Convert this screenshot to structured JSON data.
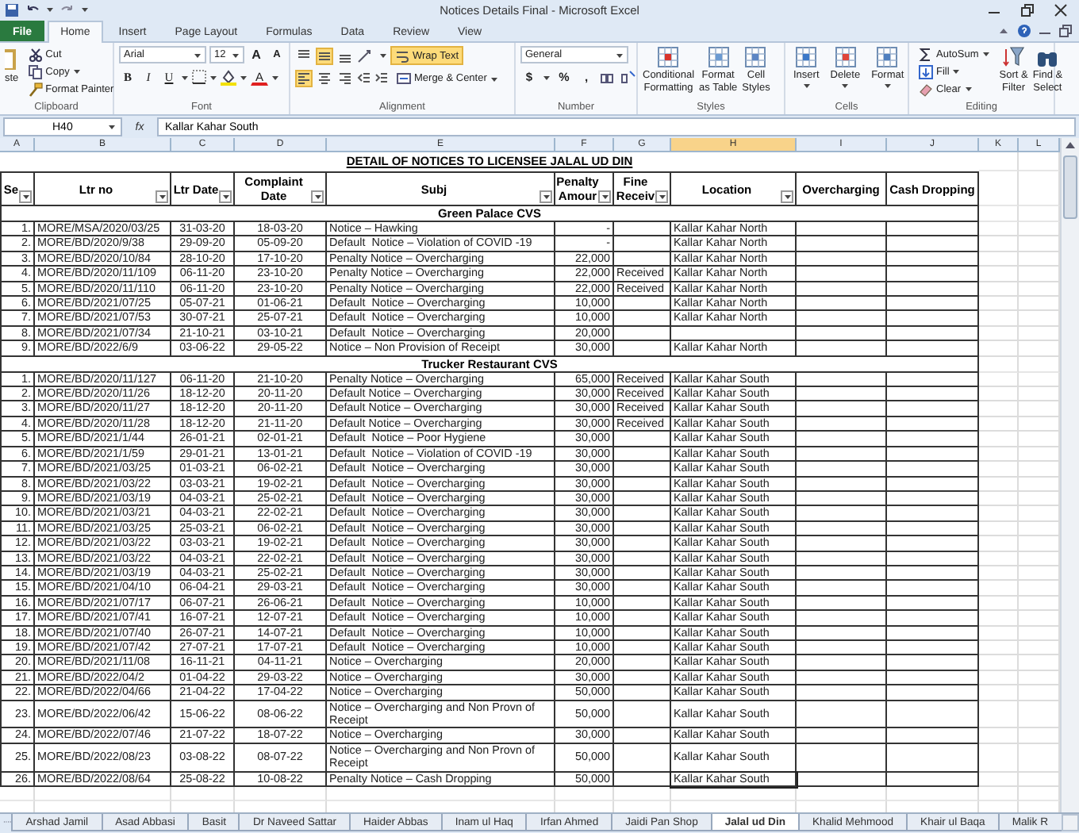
{
  "window": {
    "title": "Notices Details Final  -  Microsoft Excel"
  },
  "ribbon_tabs": [
    {
      "label": "File",
      "selected": false,
      "kind": "file"
    },
    {
      "label": "Home",
      "selected": true,
      "kind": "tab"
    },
    {
      "label": "Insert",
      "selected": false,
      "kind": "tab"
    },
    {
      "label": "Page Layout",
      "selected": false,
      "kind": "tab"
    },
    {
      "label": "Formulas",
      "selected": false,
      "kind": "tab"
    },
    {
      "label": "Data",
      "selected": false,
      "kind": "tab"
    },
    {
      "label": "Review",
      "selected": false,
      "kind": "tab"
    },
    {
      "label": "View",
      "selected": false,
      "kind": "tab"
    }
  ],
  "ribbon_groups": [
    {
      "kind": "clipboard",
      "label": "Clipboard",
      "paste": "ste",
      "buttons": [
        "Cut",
        "Copy",
        "Format Painter"
      ]
    },
    {
      "kind": "font",
      "label": "Font",
      "font_name": "Arial",
      "font_size": "12",
      "size_buttons": [
        "A",
        "A"
      ],
      "style_buttons": [
        "B",
        "I",
        "U"
      ],
      "color_button": "A"
    },
    {
      "kind": "alignment",
      "label": "Alignment",
      "align_buttons": [
        {
          "kind": "top",
          "selected": false
        },
        {
          "kind": "middle",
          "selected": true
        },
        {
          "kind": "bottom",
          "selected": false
        },
        {
          "kind": "left",
          "selected": true
        },
        {
          "kind": "center",
          "selected": false
        },
        {
          "kind": "right",
          "selected": false
        }
      ],
      "wrap": {
        "label": "Wrap Text",
        "selected": true
      },
      "merge": "Merge & Center"
    },
    {
      "kind": "number",
      "label": "Number",
      "format": "General",
      "buttons": [
        "$",
        "%",
        ","
      ]
    },
    {
      "kind": "styles",
      "label": "Styles",
      "buttons": [
        [
          "Conditional",
          "Formatting"
        ],
        [
          "Format",
          "as Table"
        ],
        [
          "Cell",
          "Styles"
        ]
      ]
    },
    {
      "kind": "cells",
      "label": "Cells",
      "buttons": [
        "Insert",
        "Delete",
        "Format"
      ]
    },
    {
      "kind": "editing",
      "label": "Editing",
      "small": [
        "AutoSum",
        "Fill",
        "Clear"
      ],
      "big": [
        [
          "Sort &",
          "Filter"
        ],
        [
          "Find &",
          "Select"
        ]
      ]
    }
  ],
  "formula_bar": {
    "cell_ref": "H40",
    "fx": "fx",
    "value": "Kallar Kahar South"
  },
  "column_letters": [
    {
      "letter": "A",
      "selected": false
    },
    {
      "letter": "B",
      "selected": false
    },
    {
      "letter": "C",
      "selected": false
    },
    {
      "letter": "D",
      "selected": false
    },
    {
      "letter": "E",
      "selected": false
    },
    {
      "letter": "F",
      "selected": false
    },
    {
      "letter": "G",
      "selected": false
    },
    {
      "letter": "H",
      "selected": true
    },
    {
      "letter": "I",
      "selected": false
    },
    {
      "letter": "J",
      "selected": false
    },
    {
      "letter": "K",
      "selected": false
    },
    {
      "letter": "L",
      "selected": false
    }
  ],
  "sheet_title": "DETAIL OF NOTICES TO LICENSEE JALAL UD DIN",
  "columns": [
    {
      "label": "Se",
      "filter": true
    },
    {
      "label": "Ltr no",
      "filter": true
    },
    {
      "label": "Ltr Date",
      "filter": true
    },
    {
      "label": "Complaint Date",
      "filter": true
    },
    {
      "label": "Subj",
      "filter": true
    },
    {
      "label": "Penalty Amour",
      "filter": true
    },
    {
      "label": "Fine Receiv",
      "filter": true
    },
    {
      "label": "Location",
      "filter": true
    },
    {
      "label": "Overcharging",
      "filter": false
    },
    {
      "label": "Cash Dropping",
      "filter": false
    }
  ],
  "sections": [
    {
      "title": "Green Palace CVS",
      "rows": [
        {
          "ser": "1.",
          "ltr_no": "MORE/MSA/2020/03/25",
          "ltr_date": "31-03-20",
          "complaint_date": "18-03-20",
          "subj": "Notice – Hawking",
          "penalty": "-",
          "location": "Kallar Kahar North",
          "selected": false
        },
        {
          "ser": "2.",
          "ltr_no": "MORE/BD/2020/9/38",
          "ltr_date": "29-09-20",
          "complaint_date": "05-09-20",
          "subj": "Default  Notice – Violation of COVID -19",
          "penalty": "-",
          "location": "Kallar Kahar North",
          "selected": false
        },
        {
          "ser": "3.",
          "ltr_no": "MORE/BD/2020/10/84",
          "ltr_date": "28-10-20",
          "complaint_date": "17-10-20",
          "subj": "Penalty Notice – Overcharging",
          "penalty": "22,000",
          "location": "Kallar Kahar North",
          "selected": false
        },
        {
          "ser": "4.",
          "ltr_no": "MORE/BD/2020/11/109",
          "ltr_date": "06-11-20",
          "complaint_date": "23-10-20",
          "subj": "Penalty Notice – Overcharging",
          "penalty": "22,000",
          "fine": "Received",
          "location": "Kallar Kahar North",
          "selected": false
        },
        {
          "ser": "5.",
          "ltr_no": "MORE/BD/2020/11/110",
          "ltr_date": "06-11-20",
          "complaint_date": "23-10-20",
          "subj": "Penalty Notice – Overcharging",
          "penalty": "22,000",
          "fine": "Received",
          "location": "Kallar Kahar North",
          "selected": false
        },
        {
          "ser": "6.",
          "ltr_no": "MORE/BD/2021/07/25",
          "ltr_date": "05-07-21",
          "complaint_date": "01-06-21",
          "subj": "Default  Notice – Overcharging",
          "penalty": "10,000",
          "location": "Kallar Kahar North",
          "selected": false
        },
        {
          "ser": "7.",
          "ltr_no": "MORE/BD/2021/07/53",
          "ltr_date": "30-07-21",
          "complaint_date": "25-07-21",
          "subj": "Default  Notice – Overcharging",
          "penalty": "10,000",
          "location": "Kallar Kahar North",
          "selected": false
        },
        {
          "ser": "8.",
          "ltr_no": "MORE/BD/2021/07/34",
          "ltr_date": "21-10-21",
          "complaint_date": "03-10-21",
          "subj": "Default  Notice – Overcharging",
          "penalty": "20,000",
          "selected": false
        },
        {
          "ser": "9.",
          "ltr_no": "MORE/BD/2022/6/9",
          "ltr_date": "03-06-22",
          "complaint_date": "29-05-22",
          "subj": "Notice – Non Provision of Receipt",
          "penalty": "30,000",
          "location": "Kallar Kahar North",
          "selected": false
        }
      ]
    },
    {
      "title": "Trucker Restaurant  CVS",
      "rows": [
        {
          "ser": "1.",
          "ltr_no": "MORE/BD/2020/11/127",
          "ltr_date": "06-11-20",
          "complaint_date": "21-10-20",
          "subj": "Penalty Notice – Overcharging",
          "penalty": "65,000",
          "fine": "Received",
          "location": "Kallar Kahar South",
          "selected": false
        },
        {
          "ser": "2.",
          "ltr_no": "MORE/BD/2020/11/26",
          "ltr_date": "18-12-20",
          "complaint_date": "20-11-20",
          "subj": "Default Notice – Overcharging",
          "penalty": "30,000",
          "fine": "Received",
          "location": "Kallar Kahar South",
          "selected": false
        },
        {
          "ser": "3.",
          "ltr_no": "MORE/BD/2020/11/27",
          "ltr_date": "18-12-20",
          "complaint_date": "20-11-20",
          "subj": "Default Notice – Overcharging",
          "penalty": "30,000",
          "fine": "Received",
          "location": "Kallar Kahar South",
          "selected": false
        },
        {
          "ser": "4.",
          "ltr_no": "MORE/BD/2020/11/28",
          "ltr_date": "18-12-20",
          "complaint_date": "21-11-20",
          "subj": "Default Notice – Overcharging",
          "penalty": "30,000",
          "fine": "Received",
          "location": "Kallar Kahar South",
          "selected": false
        },
        {
          "ser": "5.",
          "ltr_no": "MORE/BD/2021/1/44",
          "ltr_date": "26-01-21",
          "complaint_date": "02-01-21",
          "subj": "Default  Notice – Poor Hygiene",
          "penalty": "30,000",
          "location": "Kallar Kahar South",
          "selected": false
        },
        {
          "ser": "6.",
          "ltr_no": "MORE/BD/2021/1/59",
          "ltr_date": "29-01-21",
          "complaint_date": "13-01-21",
          "subj": "Default  Notice – Violation of COVID -19",
          "penalty": "30,000",
          "location": "Kallar Kahar South",
          "selected": false
        },
        {
          "ser": "7.",
          "ltr_no": "MORE/BD/2021/03/25",
          "ltr_date": "01-03-21",
          "complaint_date": "06-02-21",
          "subj": "Default  Notice – Overcharging",
          "penalty": "30,000",
          "location": "Kallar Kahar South",
          "selected": false
        },
        {
          "ser": "8.",
          "ltr_no": "MORE/BD/2021/03/22",
          "ltr_date": "03-03-21",
          "complaint_date": "19-02-21",
          "subj": "Default  Notice – Overcharging",
          "penalty": "30,000",
          "location": "Kallar Kahar South",
          "selected": false
        },
        {
          "ser": "9.",
          "ltr_no": "MORE/BD/2021/03/19",
          "ltr_date": "04-03-21",
          "complaint_date": "25-02-21",
          "subj": "Default  Notice – Overcharging",
          "penalty": "30,000",
          "location": "Kallar Kahar South",
          "selected": false
        },
        {
          "ser": "10.",
          "ltr_no": "MORE/BD/2021/03/21",
          "ltr_date": "04-03-21",
          "complaint_date": "22-02-21",
          "subj": "Default  Notice – Overcharging",
          "penalty": "30,000",
          "location": "Kallar Kahar South",
          "selected": false
        },
        {
          "ser": "11.",
          "ltr_no": "MORE/BD/2021/03/25",
          "ltr_date": "25-03-21",
          "complaint_date": "06-02-21",
          "subj": "Default  Notice – Overcharging",
          "penalty": "30,000",
          "location": "Kallar Kahar South",
          "selected": false
        },
        {
          "ser": "12.",
          "ltr_no": "MORE/BD/2021/03/22",
          "ltr_date": "03-03-21",
          "complaint_date": "19-02-21",
          "subj": "Default  Notice – Overcharging",
          "penalty": "30,000",
          "location": "Kallar Kahar South",
          "selected": false
        },
        {
          "ser": "13.",
          "ltr_no": "MORE/BD/2021/03/22",
          "ltr_date": "04-03-21",
          "complaint_date": "22-02-21",
          "subj": "Default  Notice – Overcharging",
          "penalty": "30,000",
          "location": "Kallar Kahar South",
          "selected": false
        },
        {
          "ser": "14.",
          "ltr_no": "MORE/BD/2021/03/19",
          "ltr_date": "04-03-21",
          "complaint_date": "25-02-21",
          "subj": "Default  Notice – Overcharging",
          "penalty": "30,000",
          "location": "Kallar Kahar South",
          "selected": false
        },
        {
          "ser": "15.",
          "ltr_no": "MORE/BD/2021/04/10",
          "ltr_date": "06-04-21",
          "complaint_date": "29-03-21",
          "subj": "Default  Notice – Overcharging",
          "penalty": "30,000",
          "location": "Kallar Kahar South",
          "selected": false
        },
        {
          "ser": "16.",
          "ltr_no": "MORE/BD/2021/07/17",
          "ltr_date": "06-07-21",
          "complaint_date": "26-06-21",
          "subj": "Default  Notice – Overcharging",
          "penalty": "10,000",
          "location": "Kallar Kahar South",
          "selected": false
        },
        {
          "ser": "17.",
          "ltr_no": "MORE/BD/2021/07/41",
          "ltr_date": "16-07-21",
          "complaint_date": "12-07-21",
          "subj": "Default  Notice – Overcharging",
          "penalty": "10,000",
          "location": "Kallar Kahar South",
          "selected": false
        },
        {
          "ser": "18.",
          "ltr_no": "MORE/BD/2021/07/40",
          "ltr_date": "26-07-21",
          "complaint_date": "14-07-21",
          "subj": "Default  Notice – Overcharging",
          "penalty": "10,000",
          "location": "Kallar Kahar South",
          "selected": false
        },
        {
          "ser": "19.",
          "ltr_no": "MORE/BD/2021/07/42",
          "ltr_date": "27-07-21",
          "complaint_date": "17-07-21",
          "subj": "Default  Notice – Overcharging",
          "penalty": "10,000",
          "location": "Kallar Kahar South",
          "selected": false
        },
        {
          "ser": "20.",
          "ltr_no": "MORE/BD/2021/11/08",
          "ltr_date": "16-11-21",
          "complaint_date": "04-11-21",
          "subj": "Notice – Overcharging",
          "penalty": "20,000",
          "location": "Kallar Kahar South",
          "selected": false
        },
        {
          "ser": "21.",
          "ltr_no": "MORE/BD/2022/04/2",
          "ltr_date": "01-04-22",
          "complaint_date": "29-03-22",
          "subj": "Notice – Overcharging",
          "penalty": "30,000",
          "location": "Kallar Kahar South",
          "selected": false
        },
        {
          "ser": "22.",
          "ltr_no": "MORE/BD/2022/04/66",
          "ltr_date": "21-04-22",
          "complaint_date": "17-04-22",
          "subj": "Notice – Overcharging",
          "penalty": "50,000",
          "location": "Kallar Kahar South",
          "selected": false
        },
        {
          "ser": "23.",
          "ltr_no": "MORE/BD/2022/06/42",
          "ltr_date": "15-06-22",
          "complaint_date": "08-06-22",
          "subj": "Notice – Overcharging and Non Provn of Receipt",
          "penalty": "50,000",
          "location": "Kallar Kahar South",
          "selected": false
        },
        {
          "ser": "24.",
          "ltr_no": "MORE/BD/2022/07/46",
          "ltr_date": "21-07-22",
          "complaint_date": "18-07-22",
          "subj": "Notice – Overcharging",
          "penalty": "30,000",
          "location": "Kallar Kahar South",
          "selected": false
        },
        {
          "ser": "25.",
          "ltr_no": "MORE/BD/2022/08/23",
          "ltr_date": "03-08-22",
          "complaint_date": "08-07-22",
          "subj": "Notice – Overcharging and Non Provn of Receipt",
          "penalty": "50,000",
          "location": "Kallar Kahar South",
          "selected": false
        },
        {
          "ser": "26.",
          "ltr_no": "MORE/BD/2022/08/64",
          "ltr_date": "25-08-22",
          "complaint_date": "10-08-22",
          "subj": "Penalty Notice – Cash Dropping",
          "penalty": "50,000",
          "location": "Kallar Kahar South",
          "selected": true
        }
      ]
    }
  ],
  "sheet_tabs": [
    {
      "label": "Arshad Jamil",
      "selected": false
    },
    {
      "label": "Asad Abbasi",
      "selected": false
    },
    {
      "label": "Basit",
      "selected": false
    },
    {
      "label": "Dr Naveed Sattar",
      "selected": false
    },
    {
      "label": "Haider Abbas",
      "selected": false
    },
    {
      "label": "Inam ul Haq",
      "selected": false
    },
    {
      "label": "Irfan Ahmed",
      "selected": false
    },
    {
      "label": "Jaidi Pan Shop",
      "selected": false
    },
    {
      "label": "Jalal ud Din",
      "selected": true
    },
    {
      "label": "Khalid Mehmood",
      "selected": false
    },
    {
      "label": "Khair ul Baqa",
      "selected": false
    },
    {
      "label": "Malik R",
      "selected": false
    }
  ]
}
